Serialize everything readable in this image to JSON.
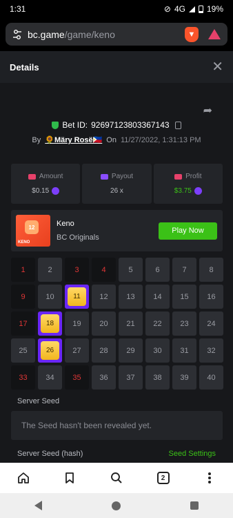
{
  "status": {
    "time": "1:31",
    "network": "4G",
    "battery": "19%"
  },
  "browser": {
    "url_domain": "bc.game",
    "url_path": "/game/keno",
    "tab_count": "2"
  },
  "header": {
    "title": "Details"
  },
  "bet": {
    "label": "Bet ID:",
    "id": "92697123803367143",
    "by_label": "By",
    "user": "🌻Märy Rosë🇵🇭",
    "on_label": "On",
    "date": "11/27/2022, 1:31:13 PM"
  },
  "stats": {
    "amount_label": "Amount",
    "amount_value": "$0.15",
    "payout_label": "Payout",
    "payout_value": "26 x",
    "profit_label": "Profit",
    "profit_value": "$3.75"
  },
  "game": {
    "name": "Keno",
    "provider": "BC Originals",
    "play_label": "Play Now",
    "thumb_num": "12",
    "thumb_text": "KENO"
  },
  "grid": {
    "numbers": [
      "1",
      "2",
      "3",
      "4",
      "5",
      "6",
      "7",
      "8",
      "9",
      "10",
      "11",
      "12",
      "13",
      "14",
      "15",
      "16",
      "17",
      "18",
      "19",
      "20",
      "21",
      "22",
      "23",
      "24",
      "25",
      "26",
      "27",
      "28",
      "29",
      "30",
      "31",
      "32",
      "33",
      "34",
      "35",
      "36",
      "37",
      "38",
      "39",
      "40"
    ],
    "misses": [
      1,
      3,
      4,
      9,
      17,
      33,
      35
    ],
    "hits": [
      11,
      18,
      26
    ]
  },
  "seed": {
    "server_seed_label": "Server Seed",
    "server_seed_value": "The Seed hasn't been revealed yet.",
    "hash_label": "Server Seed (hash)",
    "settings_label": "Seed Settings"
  },
  "colors": {
    "accent_green": "#3bc117",
    "hit_purple": "#6a26f5",
    "miss_red": "#e03636"
  }
}
